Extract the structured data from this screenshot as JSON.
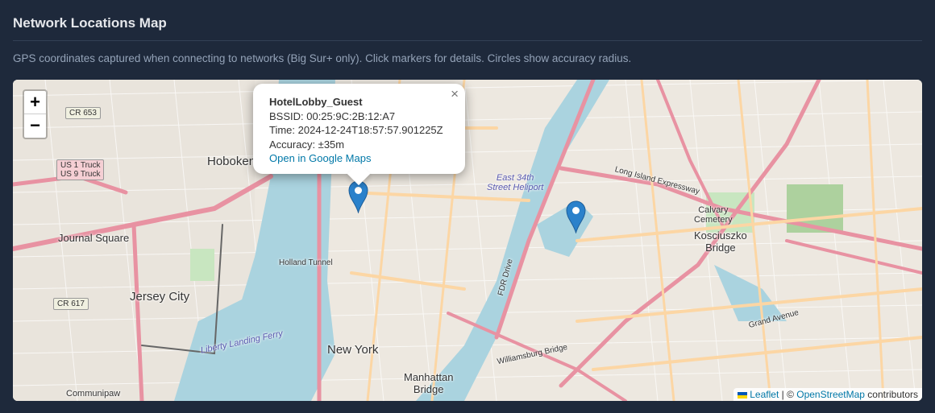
{
  "header": {
    "title": "Network Locations Map",
    "description": "GPS coordinates captured when connecting to networks (Big Sur+ only). Click markers for details. Circles show accuracy radius."
  },
  "zoom": {
    "in": "+",
    "out": "−"
  },
  "popup": {
    "ssid": "HotelLobby_Guest",
    "bssid": "BSSID: 00:25:9C:2B:12:A7",
    "time": "Time: 2024-12-24T18:57:57.901225Z",
    "accuracy": "Accuracy: ±35m",
    "link": "Open in Google Maps",
    "close": "×"
  },
  "map_labels": {
    "hoboken": "Hoboken",
    "journal_square": "Journal Square",
    "jersey_city": "Jersey City",
    "new_york": "New York",
    "manhattan_bridge": "Manhattan\nBridge",
    "kosciuszko": "Kosciuszko\nBridge",
    "calvary": "Calvary\nCemetery",
    "communipaw": "Communipaw",
    "heliport": "East 34th\nStreet Heliport",
    "holland_tunnel": "Holland Tunnel",
    "williamsburg_bridge": "Williamsburg Bridge",
    "lie": "Long Island Expressway",
    "grand_avenue": "Grand Avenue",
    "fdr_drive": "FDR Drive",
    "liberty_ferry": "Liberty Landing Ferry"
  },
  "shields": {
    "cr653": "CR 653",
    "cr617": "CR 617",
    "us1": "US 1 Truck\nUS 9 Truck"
  },
  "attribution": {
    "leaflet": "Leaflet",
    "sep": " | © ",
    "osm": "OpenStreetMap",
    "contributors": " contributors"
  },
  "colors": {
    "marker": "#2a81cb",
    "water": "#aad3df",
    "motorway": "#e892a2",
    "primary": "#fcd6a4"
  }
}
